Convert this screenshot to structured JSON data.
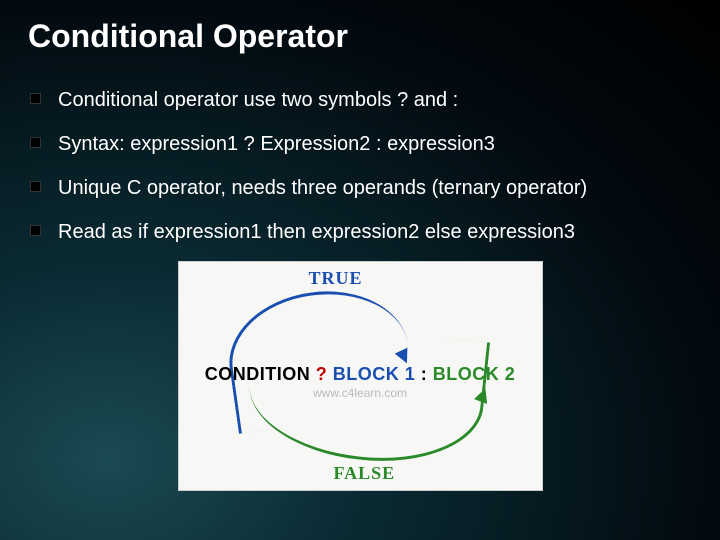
{
  "title": "Conditional Operator",
  "bullets": [
    "Conditional operator use two symbols ? and :",
    "Syntax: expression1 ? Expression2 : expression3",
    "Unique C operator, needs three operands (ternary operator)",
    "Read as if expression1 then expression2 else expression3"
  ],
  "diagram": {
    "true_label": "TRUE",
    "false_label": "FALSE",
    "condition": "CONDITION",
    "qmark": " ? ",
    "block1": "BLOCK 1",
    "colon": " : ",
    "block2": "BLOCK 2",
    "watermark": "www.c4learn.com"
  }
}
